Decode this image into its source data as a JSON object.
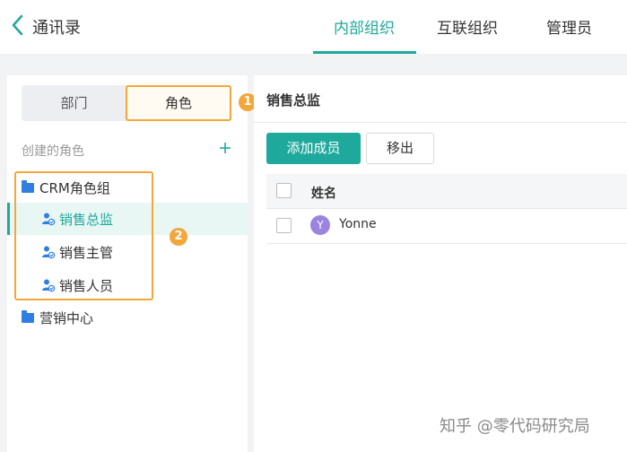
{
  "header": {
    "title": "通讯录",
    "tabs": [
      {
        "label": "内部组织",
        "active": true
      },
      {
        "label": "互联组织",
        "active": false
      },
      {
        "label": "管理员",
        "active": false
      }
    ]
  },
  "sidebar": {
    "segment": {
      "dept_label": "部门",
      "role_label": "角色",
      "selected": "角色"
    },
    "callout_1": "1",
    "callout_2": "2",
    "section_label": "创建的角色",
    "groups": [
      {
        "name": "CRM角色组",
        "roles": [
          {
            "label": "销售总监",
            "active": true
          },
          {
            "label": "销售主管",
            "active": false
          },
          {
            "label": "销售人员",
            "active": false
          }
        ]
      },
      {
        "name": "营销中心",
        "roles": []
      }
    ]
  },
  "main": {
    "title": "销售总监",
    "add_button": "添加成员",
    "remove_button": "移出",
    "table": {
      "columns": [
        "姓名"
      ],
      "rows": [
        {
          "avatar": "Y",
          "name": "Yonne"
        }
      ]
    }
  },
  "watermark": "知乎 @零代码研究局",
  "colors": {
    "accent": "#1fa89c",
    "highlight": "#f3a73b",
    "folder": "#2f7fe0",
    "avatar": "#9b84e0"
  },
  "icons": {
    "back": "chevron-left-icon",
    "add": "plus-icon",
    "group": "folder-icon",
    "role": "user-role-icon"
  }
}
